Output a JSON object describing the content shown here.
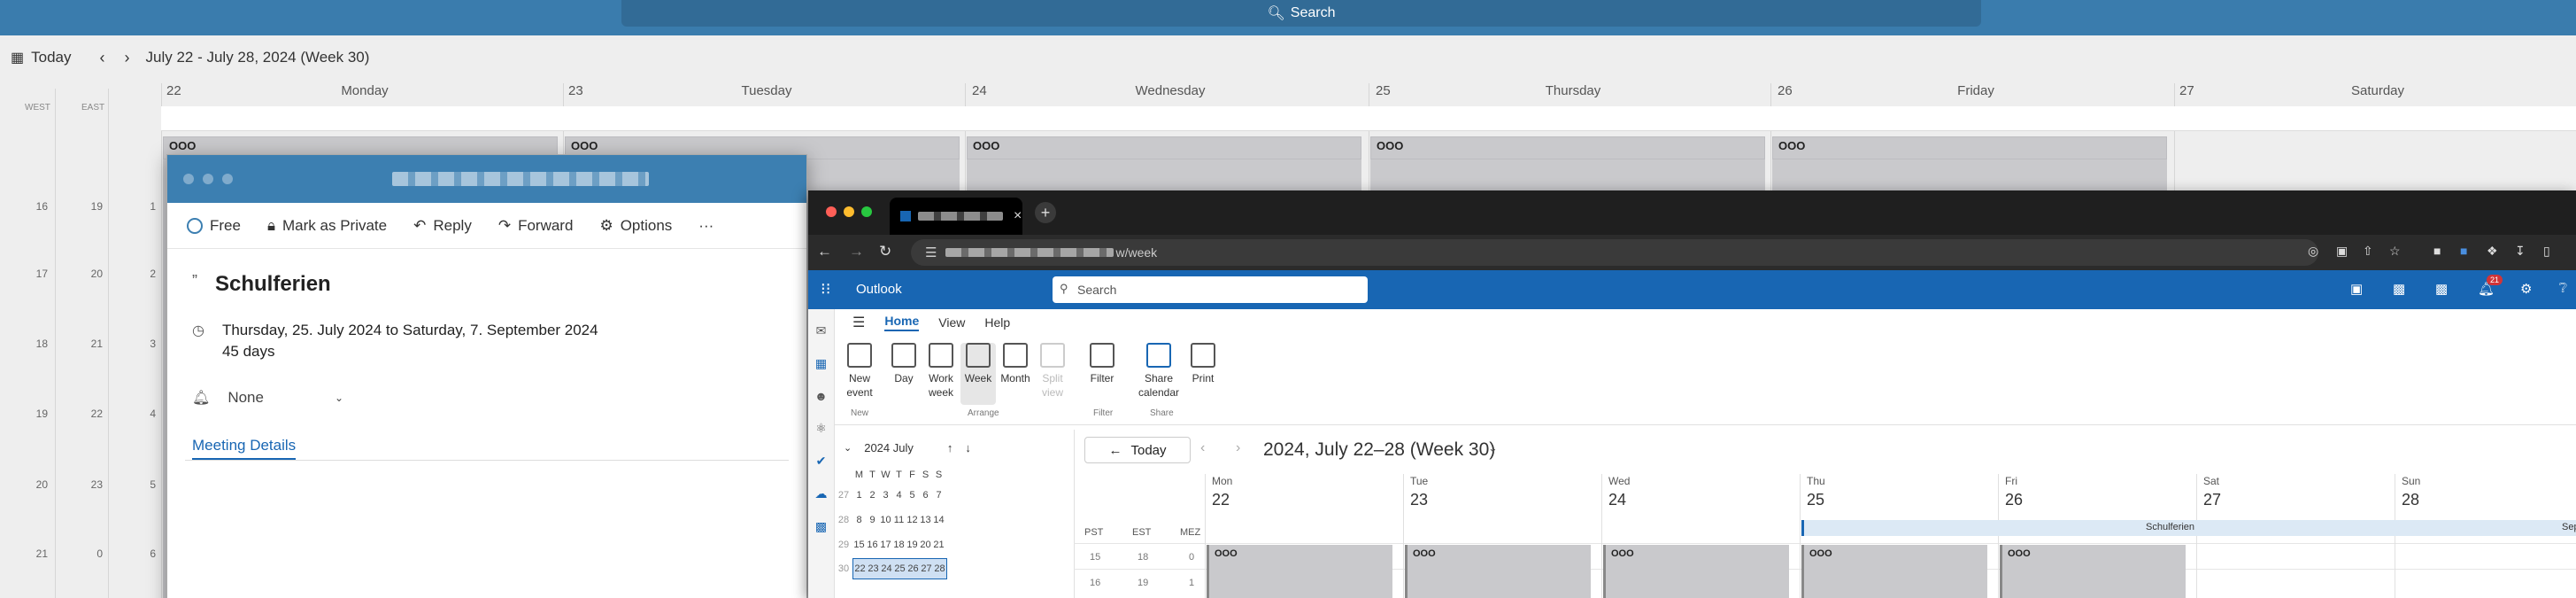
{
  "bg": {
    "search_label": "Search",
    "today_label": "Today",
    "range_label": "July 22 - July 28, 2024 (Week 30)",
    "tz_west": "WEST",
    "tz_east": "EAST",
    "days": [
      {
        "num": "22",
        "name": "Monday"
      },
      {
        "num": "23",
        "name": "Tuesday"
      },
      {
        "num": "24",
        "name": "Wednesday"
      },
      {
        "num": "25",
        "name": "Thursday"
      },
      {
        "num": "26",
        "name": "Friday"
      },
      {
        "num": "27",
        "name": "Saturday"
      }
    ],
    "ooo_label": "OOO",
    "hours_west": [
      "16",
      "17",
      "18",
      "19",
      "20",
      "21"
    ],
    "hours_east": [
      "19",
      "20",
      "21",
      "22",
      "23",
      "0"
    ],
    "hours_local": [
      "1",
      "2",
      "3",
      "4",
      "5",
      "6"
    ]
  },
  "event": {
    "free_label": "Free",
    "private_label": "Mark as Private",
    "reply_label": "Reply",
    "forward_label": "Forward",
    "options_label": "Options",
    "more_label": "···",
    "title": "Schulferien",
    "date_range": "Thursday, 25. July 2024 to Saturday, 7. September 2024",
    "duration": "45 days",
    "reminder": "None",
    "meeting_details_label": "Meeting Details"
  },
  "browser": {
    "url_suffix": "w/week",
    "app_name": "Outlook",
    "search_placeholder": "Search",
    "notification_count": "21",
    "ribbon_tabs": [
      "Home",
      "View",
      "Help"
    ],
    "ribbon_buttons": {
      "new_event": "New event",
      "day": "Day",
      "work_week": "Work week",
      "week": "Week",
      "month": "Month",
      "split_view": "Split view",
      "filter": "Filter",
      "share_calendar": "Share calendar",
      "print": "Print"
    },
    "ribbon_groups": {
      "new": "New",
      "arrange": "Arrange",
      "filter": "Filter",
      "share": "Share"
    },
    "minical": {
      "title": "2024 July",
      "weekdays": [
        "M",
        "T",
        "W",
        "T",
        "F",
        "S",
        "S"
      ],
      "weeks": [
        {
          "wk": "27",
          "days": [
            "1",
            "2",
            "3",
            "4",
            "5",
            "6",
            "7"
          ]
        },
        {
          "wk": "28",
          "days": [
            "8",
            "9",
            "10",
            "11",
            "12",
            "13",
            "14"
          ]
        },
        {
          "wk": "29",
          "days": [
            "15",
            "16",
            "17",
            "18",
            "19",
            "20",
            "21"
          ]
        },
        {
          "wk": "30",
          "days": [
            "22",
            "23",
            "24",
            "25",
            "26",
            "27",
            "28"
          ]
        }
      ]
    },
    "today_button": "Today",
    "range_title": "2024, July 22–28 (Week 30)",
    "tz_labels": [
      "PST",
      "EST",
      "MEZ"
    ],
    "tz_row1": [
      "15",
      "18",
      "0"
    ],
    "tz_row2": [
      "16",
      "19",
      "1"
    ],
    "columns": [
      {
        "short": "Mon",
        "num": "22"
      },
      {
        "short": "Tue",
        "num": "23"
      },
      {
        "short": "Wed",
        "num": "24"
      },
      {
        "short": "Thu",
        "num": "25"
      },
      {
        "short": "Fri",
        "num": "26"
      },
      {
        "short": "Sat",
        "num": "27"
      },
      {
        "short": "Sun",
        "num": "28"
      }
    ],
    "allday_event": "Schulferien",
    "allday_event_cut": "Sep",
    "ooo_label": "OOO"
  },
  "colors": {
    "outlook_blue": "#1866b3",
    "titlebar_blue": "#3c7fb1",
    "ooo_grey": "#c9c9cc",
    "schulferien_bg": "#dce9f5"
  }
}
